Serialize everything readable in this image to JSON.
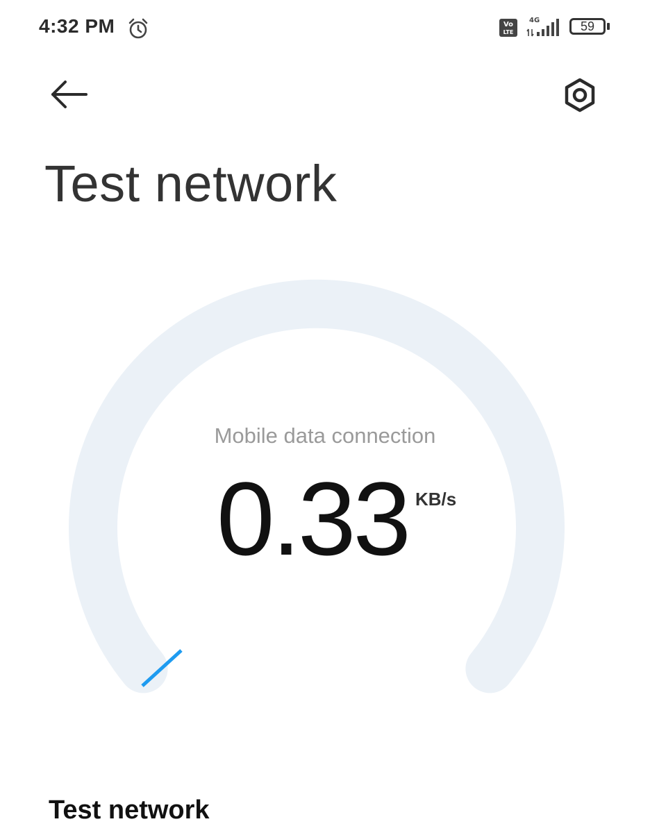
{
  "status_bar": {
    "time": "4:32 PM",
    "alarm_icon": "alarm-clock-icon",
    "volte_label_top": "Vo",
    "volte_label_bottom": "LTE",
    "network_type": "4G",
    "battery_level": "59"
  },
  "header": {
    "back_icon": "arrow-left-icon",
    "settings_icon": "settings-hexagon-icon",
    "title": "Test network"
  },
  "gauge": {
    "label": "Mobile data connection",
    "value": "0.33",
    "unit": "KB/s",
    "track_color": "#ebf1f7",
    "accent_color": "#1e9bf0"
  },
  "section": {
    "title": "Test network"
  }
}
